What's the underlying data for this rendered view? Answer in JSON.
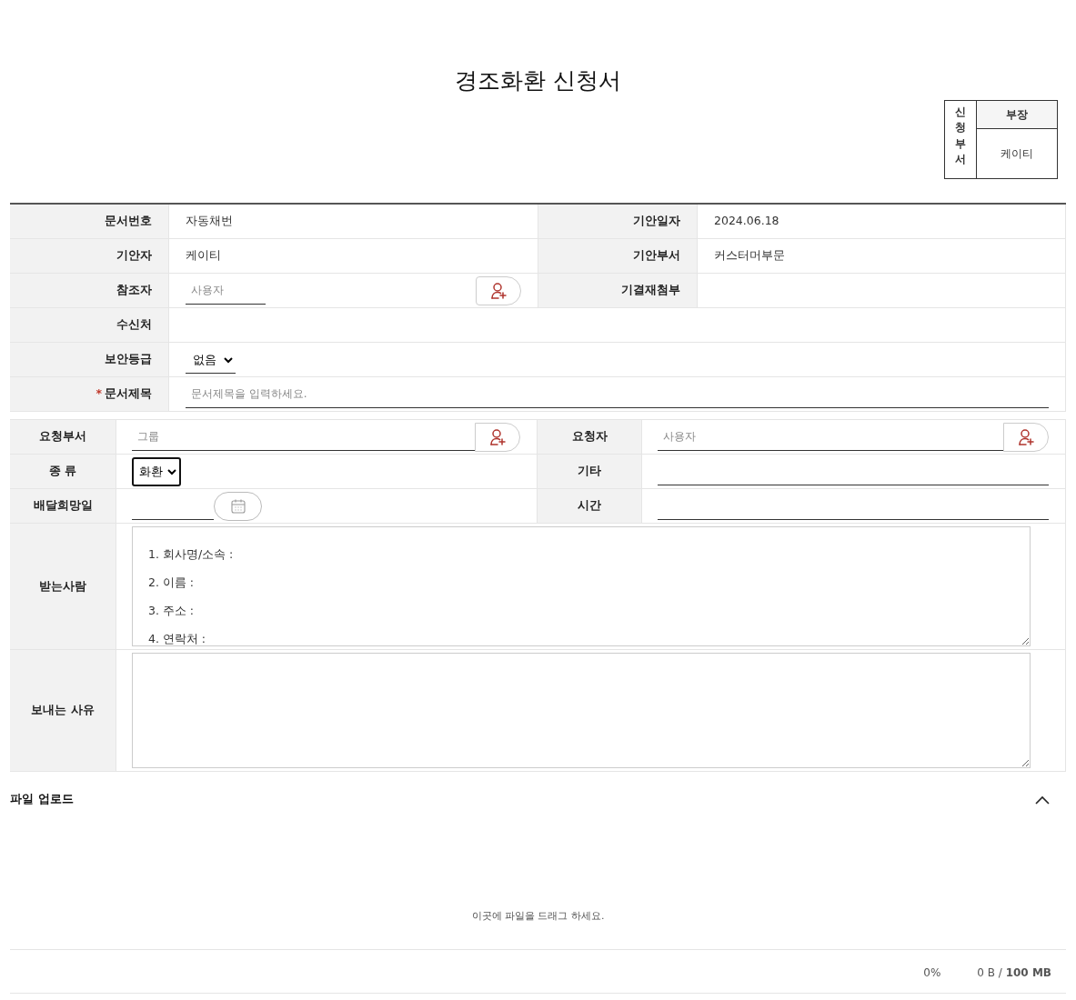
{
  "title": "경조화환 신청서",
  "approval": {
    "side_label": "신청부서",
    "header": "부장",
    "name": "케이티"
  },
  "document_table": [
    [
      {
        "label": "문서번호",
        "kind": "text",
        "value": "자동채번"
      },
      {
        "label": "기안일자",
        "kind": "text",
        "value": "2024.06.18"
      }
    ],
    [
      {
        "label": "기안자",
        "kind": "text",
        "value": "케이티"
      },
      {
        "label": "기안부서",
        "kind": "text",
        "value": "커스터머부문"
      }
    ],
    [
      {
        "label": "참조자",
        "kind": "user_picker_short",
        "placeholder": "사용자"
      },
      {
        "label": "기결재첨부",
        "kind": "empty"
      }
    ],
    [
      {
        "label": "수신처",
        "kind": "empty"
      }
    ],
    [
      {
        "label": "보안등급",
        "kind": "select_line",
        "value": "없음"
      }
    ],
    [
      {
        "label": "문서제목",
        "kind": "input",
        "placeholder": "문서제목을 입력하세요.",
        "required_mark": "*"
      }
    ]
  ],
  "request_table": [
    [
      {
        "label": "요청부서",
        "kind": "user_picker",
        "placeholder": "그룹"
      },
      {
        "label": "요청자",
        "kind": "user_picker",
        "placeholder": "사용자"
      }
    ],
    [
      {
        "label": "종 류",
        "kind": "select_box",
        "value": "화환"
      },
      {
        "label": "기타",
        "kind": "input"
      }
    ],
    [
      {
        "label": "배달희망일",
        "kind": "date"
      },
      {
        "label": "시간",
        "kind": "input"
      }
    ],
    [
      {
        "label": "받는사람",
        "kind": "textarea",
        "value": "1. 회사명/소속 :\n2. 이름 :\n3. 주소 :\n4. 연락처 :"
      }
    ],
    [
      {
        "label": "보내는 사유",
        "kind": "textarea"
      }
    ]
  ],
  "file_upload": {
    "title": "파일 업로드",
    "expanded": true,
    "drop_hint": "이곳에 파일을 드래그 하세요.",
    "progress": "0%",
    "size": "0 B / **100 MB**"
  }
}
